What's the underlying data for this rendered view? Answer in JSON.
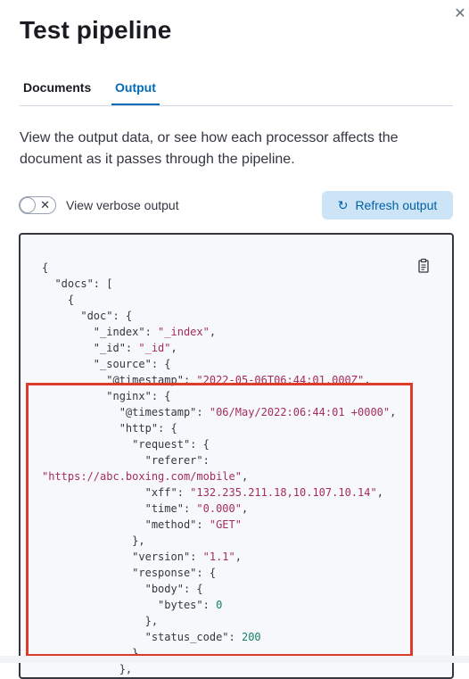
{
  "flyout": {
    "title": "Test pipeline",
    "close_icon": "close-icon"
  },
  "tabs": [
    {
      "label": "Documents",
      "selected": false
    },
    {
      "label": "Output",
      "selected": true
    }
  ],
  "description": "View the output data, or see how each processor affects the document as it passes through the pipeline.",
  "verbose": {
    "label": "View verbose output",
    "checked": false
  },
  "refresh_button": {
    "label": "Refresh output",
    "icon": "refresh-icon"
  },
  "output_code": [
    [
      {
        "t": "{",
        "c": "k"
      }
    ],
    [
      {
        "t": "  \"docs\": [",
        "c": "k"
      }
    ],
    [
      {
        "t": "    {",
        "c": "k"
      }
    ],
    [
      {
        "t": "      \"doc\": {",
        "c": "k"
      }
    ],
    [
      {
        "t": "        \"_index\": ",
        "c": "k"
      },
      {
        "t": "\"_index\"",
        "c": "s"
      },
      {
        "t": ",",
        "c": "k"
      }
    ],
    [
      {
        "t": "        \"_id\": ",
        "c": "k"
      },
      {
        "t": "\"_id\"",
        "c": "s"
      },
      {
        "t": ",",
        "c": "k"
      }
    ],
    [
      {
        "t": "        \"_source\": {",
        "c": "k"
      }
    ],
    [
      {
        "t": "          \"@timestamp\": ",
        "c": "k"
      },
      {
        "t": "\"2022-05-06T06:44:01.000Z\"",
        "c": "s"
      },
      {
        "t": ",",
        "c": "k"
      }
    ],
    [
      {
        "t": "          \"nginx\": {",
        "c": "k"
      }
    ],
    [
      {
        "t": "            \"@timestamp\": ",
        "c": "k"
      },
      {
        "t": "\"06/May/2022:06:44:01 +0000\"",
        "c": "s"
      },
      {
        "t": ",",
        "c": "k"
      }
    ],
    [
      {
        "t": "            \"http\": {",
        "c": "k"
      }
    ],
    [
      {
        "t": "              \"request\": {",
        "c": "k"
      }
    ],
    [
      {
        "t": "                \"referer\":",
        "c": "k"
      }
    ],
    [
      {
        "t": "\"https://abc.boxing.com/mobile\"",
        "c": "s"
      },
      {
        "t": ",",
        "c": "k"
      }
    ],
    [
      {
        "t": "                \"xff\": ",
        "c": "k"
      },
      {
        "t": "\"132.235.211.18,10.107.10.14\"",
        "c": "s"
      },
      {
        "t": ",",
        "c": "k"
      }
    ],
    [
      {
        "t": "                \"time\": ",
        "c": "k"
      },
      {
        "t": "\"0.000\"",
        "c": "s"
      },
      {
        "t": ",",
        "c": "k"
      }
    ],
    [
      {
        "t": "                \"method\": ",
        "c": "k"
      },
      {
        "t": "\"GET\"",
        "c": "s"
      }
    ],
    [
      {
        "t": "              },",
        "c": "k"
      }
    ],
    [
      {
        "t": "              \"version\": ",
        "c": "k"
      },
      {
        "t": "\"1.1\"",
        "c": "s"
      },
      {
        "t": ",",
        "c": "k"
      }
    ],
    [
      {
        "t": "              \"response\": {",
        "c": "k"
      }
    ],
    [
      {
        "t": "                \"body\": {",
        "c": "k"
      }
    ],
    [
      {
        "t": "                  \"bytes\": ",
        "c": "k"
      },
      {
        "t": "0",
        "c": "n"
      }
    ],
    [
      {
        "t": "                },",
        "c": "k"
      }
    ],
    [
      {
        "t": "                \"status_code\": ",
        "c": "k"
      },
      {
        "t": "200",
        "c": "n"
      }
    ],
    [
      {
        "t": "              }",
        "c": "k"
      }
    ],
    [
      {
        "t": "            },",
        "c": "k"
      }
    ]
  ],
  "colors": {
    "accent": "#006bb8",
    "button_bg": "#cce4f5",
    "string": "#a52d5d",
    "number": "#167d6a",
    "highlight": "#dd3b2c"
  }
}
